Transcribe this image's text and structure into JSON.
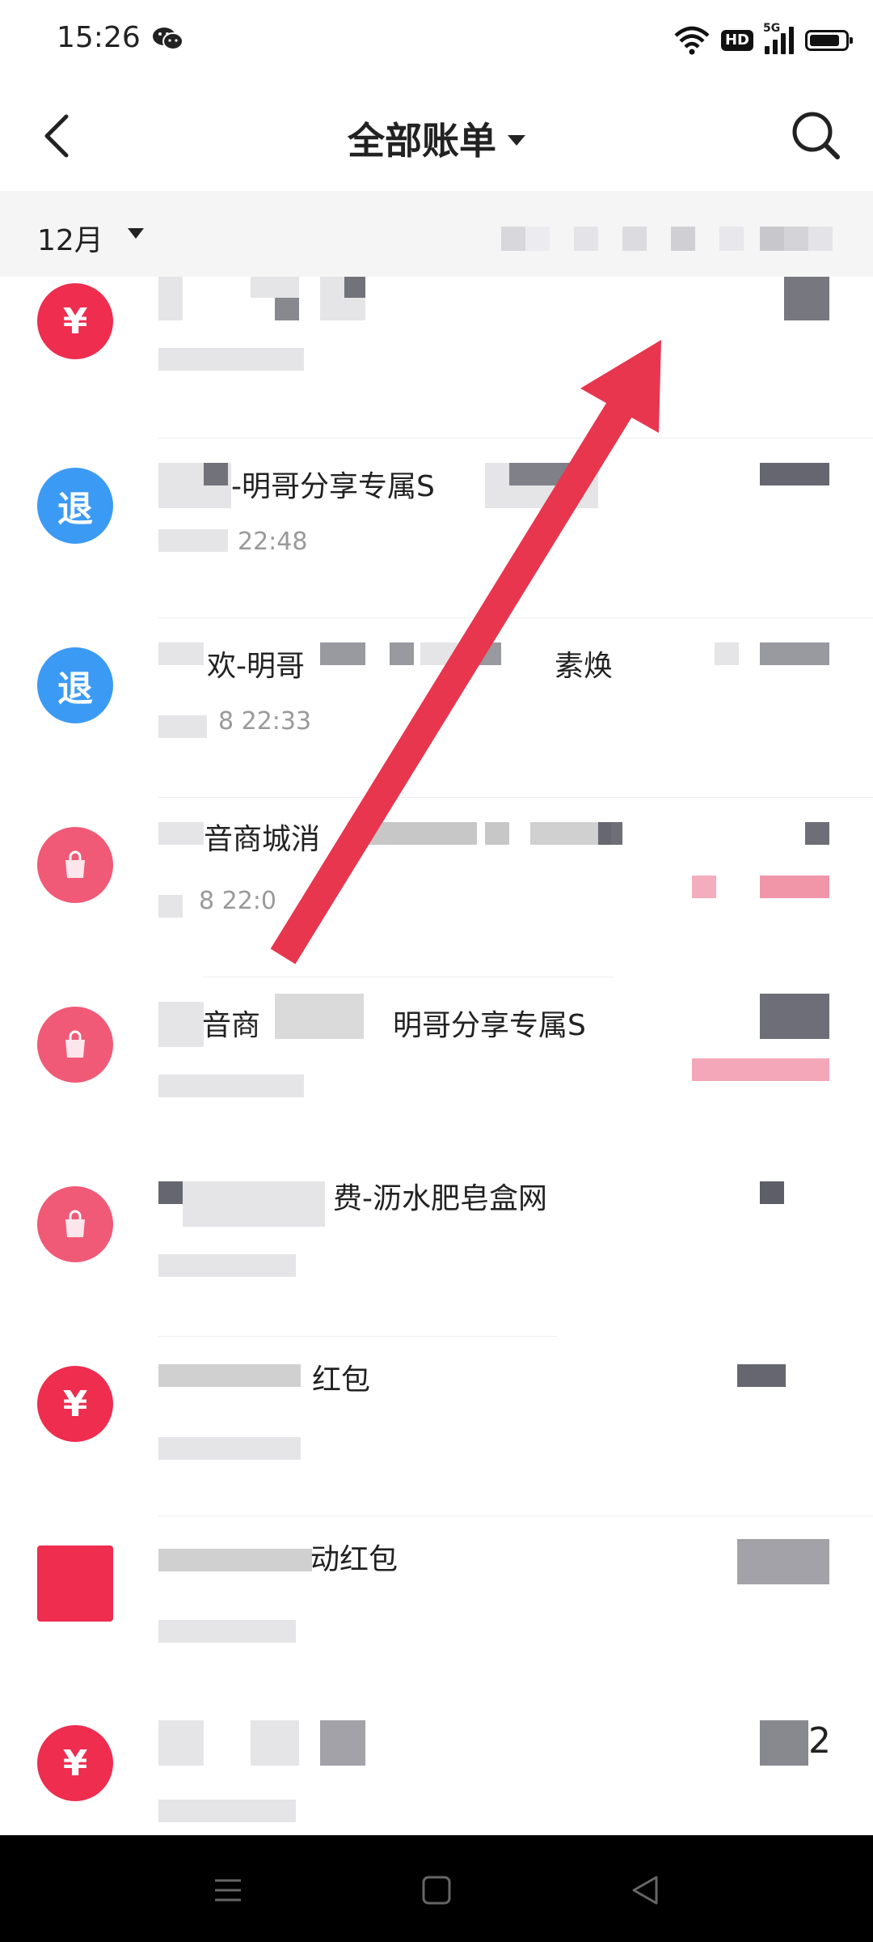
{
  "status_bar": {
    "time": "15:26",
    "hd_label": "HD",
    "network_label": "5G",
    "battery_level": 0.85,
    "icons": [
      "wechat-icon",
      "wifi-icon",
      "hd-icon",
      "signal-icon",
      "battery-icon"
    ]
  },
  "nav": {
    "title": "全部账单",
    "back_icon": "chevron-left-icon",
    "search_icon": "search-icon"
  },
  "filter": {
    "month": "12月"
  },
  "transactions": [
    {
      "icon_label": "¥",
      "icon_color": "#ee2d4f",
      "title": "",
      "time": ""
    },
    {
      "icon_label": "退",
      "icon_color": "#3b9af4",
      "title": "-明哥分享专属S",
      "time": "22:48"
    },
    {
      "icon_label": "退",
      "icon_color": "#3b9af4",
      "title": "欢-明哥",
      "title_tail": "素焕",
      "time": "8 22:33"
    },
    {
      "icon_label": "",
      "icon_color": "#f05a77",
      "title": "音商城消",
      "time": "8 22:0"
    },
    {
      "icon_label": "",
      "icon_color": "#f05a77",
      "title": "音商",
      "title_tail": "明哥分享专属S",
      "time": ""
    },
    {
      "icon_label": "",
      "icon_color": "#f05a77",
      "title": "费-沥水肥皂盒网",
      "time": ""
    },
    {
      "icon_label": "¥",
      "icon_color": "#ee2d4f",
      "title": "红包",
      "time": ""
    },
    {
      "icon_label": "",
      "icon_color": "#ee2d4f",
      "title": "动红包",
      "time": ""
    },
    {
      "icon_label": "¥",
      "icon_color": "#ee2d4f",
      "title": "",
      "time": "",
      "amount_tail": "2"
    }
  ],
  "bottom_nav": {
    "icons": [
      "menu-icon",
      "home-square-icon",
      "back-triangle-icon"
    ]
  },
  "colors": {
    "accent_red": "#ee2d4f",
    "refund_blue": "#3b9af4",
    "annotation_arrow": "#e8364f"
  }
}
